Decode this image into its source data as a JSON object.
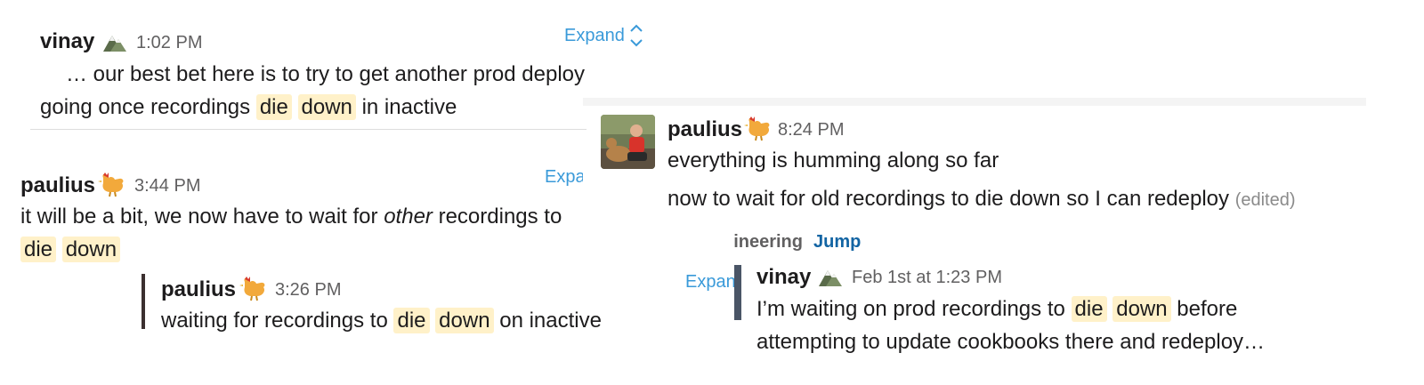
{
  "snippet_a": {
    "author": "vinay",
    "time": "1:02 PM",
    "expand": "Expand",
    "line1": "… our best bet here is to try to get another prod deploy",
    "line2_pre": "going once recordings",
    "hl1": "die",
    "hl2": "down",
    "line2_post": "in inactive"
  },
  "snippet_b": {
    "author": "paulius",
    "time": "3:44 PM",
    "expand": "Expand",
    "line1_pre": "it will be a bit, we now have to wait for",
    "line1_em": "other",
    "line1_post": "recordings to",
    "hl1": "die",
    "hl2": "down"
  },
  "snippet_c": {
    "author": "paulius",
    "time": "3:26 PM",
    "line_pre": "waiting for recordings to",
    "hl1": "die",
    "hl2": "down",
    "line_post": "on inactive"
  },
  "snippet_d": {
    "author": "paulius",
    "time": "8:24 PM",
    "line1": "everything is humming along so far",
    "line2": "now to wait for old recordings to die down so I can redeploy",
    "edited": "(edited)"
  },
  "snippet_e": {
    "channel": "engineering",
    "jump": "Jump",
    "expand": "Expand",
    "author": "vinay",
    "time": "Feb 1st at 1:23 PM",
    "line1_pre": "I’m waiting on prod recordings to",
    "hl1": "die",
    "hl2": "down",
    "line1_post": "before",
    "line2": "attempting to update cookbooks there and redeploy…"
  },
  "icons": {
    "mountain": "mountain-emoji-icon",
    "rooster": "rooster-emoji-icon"
  },
  "colors": {
    "highlight": "#fff1c9",
    "link": "#3a9ad9",
    "jump": "#1264a3"
  }
}
